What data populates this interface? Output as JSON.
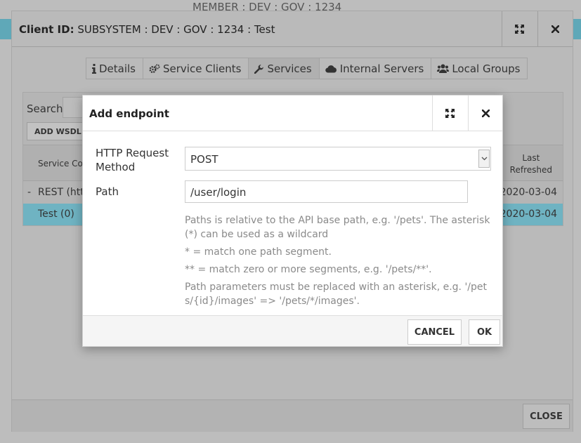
{
  "background_header": {
    "member_text": "MEMBER : DEV : GOV : 1234"
  },
  "client_dialog": {
    "title_label": "Client ID:",
    "title_value": "SUBSYSTEM : DEV : GOV : 1234 : Test",
    "tabs": [
      {
        "label": "Details",
        "icon": "info-icon"
      },
      {
        "label": "Service Clients",
        "icon": "gears-icon"
      },
      {
        "label": "Services",
        "icon": "wrench-icon"
      },
      {
        "label": "Internal Servers",
        "icon": "cloud-icon"
      },
      {
        "label": "Local Groups",
        "icon": "users-icon"
      }
    ],
    "active_tab": "Services",
    "search_label": "Search",
    "add_wsdl_label": "ADD WSDL",
    "columns": {
      "service_code": "Service Coc",
      "last_refreshed_line1": "Last",
      "last_refreshed_line2": "Refreshed"
    },
    "rows": [
      {
        "expander": "-",
        "name": "REST (http",
        "date": "2020-03-04"
      },
      {
        "expander": "",
        "name": "Test (0)",
        "date": "2020-03-04"
      }
    ],
    "close_label": "CLOSE",
    "selected_row_color": "#6fb3c2"
  },
  "add_endpoint_dialog": {
    "title": "Add endpoint",
    "method_label_line1": "HTTP Request",
    "method_label_line2": "Method",
    "method_value": "POST",
    "path_label": "Path",
    "path_value": "/user/login",
    "help": [
      "Paths is relative to the API base path, e.g. '/pets'. The asterisk (*) can be used as a wildcard",
      "* = match one path segment.",
      "** = match zero or more segments, e.g. '/pets/**'.",
      "Path parameters must be replaced with an asterisk, e.g. '/pets/{id}/images' => '/pets/*/images'."
    ],
    "cancel_label": "CANCEL",
    "ok_label": "OK"
  }
}
